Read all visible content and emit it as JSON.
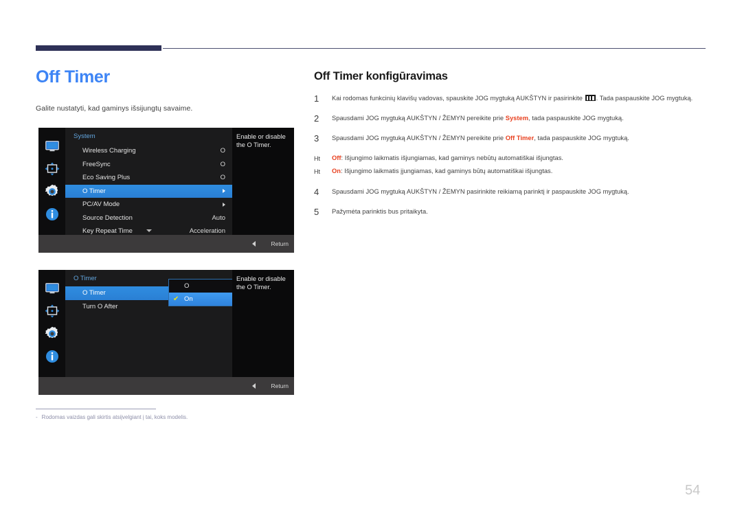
{
  "page": {
    "title": "Off Timer",
    "intro": "Galite nustatyti, kad gaminys išsijungtų savaime.",
    "number": "54"
  },
  "note": {
    "dash": "-",
    "text": "Rodomas vaizdas gali skirtis atsiįvelgiant į tai, koks modelis."
  },
  "right": {
    "title": "Off Timer konfigūravimas",
    "steps": [
      {
        "num": "1",
        "kind": "number",
        "text_before": "Kai rodomas funkcinių klavišų vadovas, spauskite JOG mygtuką AUKŠTYN ir pasirinkite ",
        "icon": "menu-glyph-icon",
        "text_after": ". Tada paspauskite JOG mygtuką."
      },
      {
        "num": "2",
        "kind": "number",
        "text_before": "Spausdami JOG mygtuką AUKŠTYN / ŽEMYN pereikite prie ",
        "highlight": "System",
        "text_after": ", tada paspauskite JOG mygtuką."
      },
      {
        "num": "3",
        "kind": "number",
        "text_before": "Spausdami JOG mygtuką AUKŠTYN / ŽEMYN pereikite prie ",
        "highlight": "Off Timer",
        "text_after": ", tada paspauskite JOG mygtuką."
      },
      {
        "num": "Ht",
        "kind": "bullet",
        "highlight": "Off",
        "text_after": ": Išjungimo laikmatis išjungiamas, kad gaminys nebūtų automatiškai išjungtas."
      },
      {
        "num": "Ht",
        "kind": "bullet",
        "highlight": "On",
        "text_after": ": Išjungimo laikmatis įjungiamas, kad gaminys būtų automatiškai išjungtas."
      },
      {
        "num": "4",
        "kind": "number",
        "text_before": "Spausdami JOG mygtuką AUKŠTYN / ŽEMYN pasirinkite reikiamą parinktį ir paspauskite JOG mygtuką.",
        "text_after": ""
      },
      {
        "num": "5",
        "kind": "number",
        "text_before": "Pažymėta parinktis bus pritaikyta.",
        "text_after": ""
      }
    ]
  },
  "osd1": {
    "menu_title": "System",
    "sidebar_icons": [
      "monitor-icon",
      "picture-adjust-icon",
      "gear-icon",
      "info-icon"
    ],
    "rows": [
      {
        "label": "Wireless Charging",
        "value": "O",
        "selected": false
      },
      {
        "label": "FreeSync",
        "value": "O",
        "selected": false
      },
      {
        "label": "Eco Saving Plus",
        "value": "O",
        "selected": false
      },
      {
        "label": "O  Timer",
        "value": "▶",
        "selected": true
      },
      {
        "label": "PC/AV Mode",
        "value": "▶",
        "selected": false
      },
      {
        "label": "Source Detection",
        "value": "Auto",
        "selected": false
      },
      {
        "label": "Key Repeat Time",
        "value": "Acceleration",
        "selected": false
      }
    ],
    "help": "Enable or disable the O  Timer.",
    "return_label": "Return"
  },
  "osd2": {
    "menu_title": "O  Timer",
    "sidebar_icons": [
      "monitor-icon",
      "picture-adjust-icon",
      "gear-icon",
      "info-icon"
    ],
    "rows": [
      {
        "label": "O  Timer",
        "value": "",
        "selected": true
      },
      {
        "label": "Turn O  After",
        "value": "",
        "selected": false
      }
    ],
    "dropdown": [
      {
        "label": "O",
        "checked": false
      },
      {
        "label": "On",
        "checked": true
      }
    ],
    "check_glyph": "✔",
    "help": "Enable or disable the O  Timer.",
    "return_label": "Return"
  },
  "colors": {
    "accent_blue": "#3d84f5",
    "rule_navy": "#2e3157",
    "highlight_red": "#e8401f",
    "osd_select_blue": "#2f8de0",
    "osd_title_blue": "#63a6df",
    "check_yellow": "#e8e11c"
  }
}
